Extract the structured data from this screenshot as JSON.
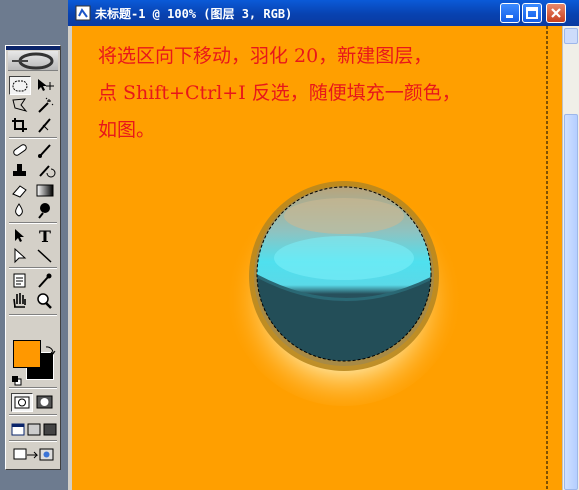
{
  "window": {
    "title": "未标题-1 @ 100% (图层 3, RGB)"
  },
  "canvas": {
    "instruction_lines": [
      "将选区向下移动，羽化 20，新建图层，",
      "点 Shift+Ctrl+I 反选，随便填充一颜色，",
      "如图。"
    ]
  },
  "toolbox": {
    "tools": [
      "marquee-tool",
      "move-tool",
      "lasso-tool",
      "magic-wand-tool",
      "crop-tool",
      "slice-tool",
      "healing-brush-tool",
      "brush-tool",
      "clone-stamp-tool",
      "history-brush-tool",
      "eraser-tool",
      "gradient-tool",
      "blur-tool",
      "dodge-tool",
      "path-selection-tool",
      "type-tool",
      "pen-tool",
      "line-tool",
      "notes-tool",
      "eyedropper-tool",
      "hand-tool",
      "zoom-tool"
    ]
  },
  "colors": {
    "foreground": "#ff9800",
    "background": "#000000",
    "canvas_bg": "#ff9f00",
    "annotation_text": "#e8171a",
    "titlebar": "#0842b0"
  }
}
